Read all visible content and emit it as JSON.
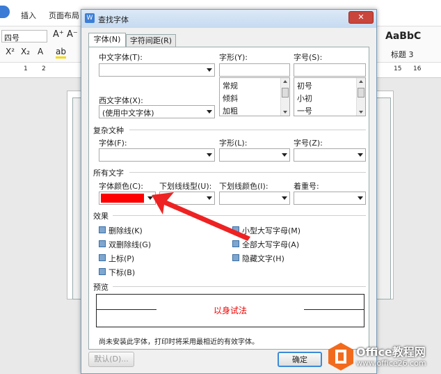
{
  "app": {
    "ribbon_tabs": [
      "插入",
      "页面布局"
    ],
    "font_size_box": "四号",
    "style_preview": "AaBbC",
    "style_label": "标题 3",
    "ruler_left": [
      "1",
      "2"
    ],
    "ruler_right": [
      "15",
      "16"
    ]
  },
  "dialog": {
    "title": "查找字体",
    "close_label": "✕",
    "tabs": [
      {
        "label": "字体(N)",
        "active": true
      },
      {
        "label": "字符间距(R)",
        "active": false
      }
    ],
    "cn_font_label": "中文字体(T):",
    "cn_font_value": "",
    "west_font_label": "西文字体(X):",
    "west_font_value": "(使用中文字体)",
    "style_label": "字形(Y):",
    "style_value": "",
    "style_options": [
      "常规",
      "倾斜",
      "加粗"
    ],
    "size_label": "字号(S):",
    "size_value": "",
    "size_options": [
      "初号",
      "小初",
      "一号"
    ],
    "complex_section": "复杂文种",
    "complex_font_label": "字体(F):",
    "complex_style_label": "字形(L):",
    "complex_size_label": "字号(Z):",
    "all_text_section": "所有文字",
    "font_color_label": "字体颜色(C):",
    "font_color_value": "#ff0000",
    "underline_type_label": "下划线线型(U):",
    "underline_color_label": "下划线颜色(I):",
    "emphasis_label": "着重号:",
    "effects_section": "效果",
    "effects_left": [
      "删除线(K)",
      "双删除线(G)",
      "上标(P)",
      "下标(B)"
    ],
    "effects_right": [
      "小型大写字母(M)",
      "全部大写字母(A)",
      "隐藏文字(H)"
    ],
    "preview_section": "预览",
    "preview_text": "以身试法",
    "note": "尚未安装此字体，打印时将采用最相近的有效字体。",
    "default_button": "默认(D)...",
    "ok_button": "确定"
  },
  "watermark": {
    "brand": "Office教程网",
    "url": "www.office26.com"
  }
}
